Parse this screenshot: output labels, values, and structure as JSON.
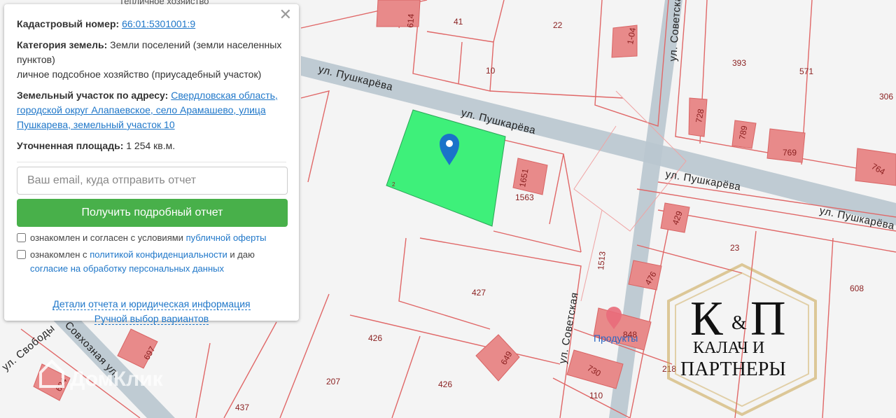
{
  "popup": {
    "cadastral_label": "Кадастровый номер:",
    "cadastral_value": "66:01:5301001:9",
    "category_label": "Категория земель:",
    "category_value": "Земли поселений (земли населенных пунктов)",
    "use_value": "личное подсобное хозяйство (приусадебный участок)",
    "address_label": "Земельный участок по адресу:",
    "address_value": "Свердловская область, городской округ Алапаевское, село Арамашево, улица Пушкарева, земельный участок 10",
    "area_label": "Уточненная площадь:",
    "area_value": "1 254 кв.м.",
    "email_placeholder": "Ваш email, куда отправить отчет",
    "submit_label": "Получить подробный отчет",
    "check1_text": "ознакомлен и согласен с условиями",
    "check1_link": "публичной оферты",
    "check2_text": "ознакомлен с",
    "check2_link": "политикой конфиденциальности",
    "check2_text_b": "и даю",
    "check2_link_b": "согласие на обработку персональных данных",
    "details_link": "Детали отчета и юридическая информация",
    "manual_link": "Ручной выбор вариантов",
    "close_icon": "close-icon"
  },
  "map": {
    "streets": [
      {
        "label": "ул. Пушкарёва"
      },
      {
        "label": "ул. Пушкарёва"
      },
      {
        "label": "ул. Пушкарёва"
      },
      {
        "label": "ул. Пушкарёва"
      },
      {
        "label": "ул. Советская"
      },
      {
        "label": "ул. Советская"
      },
      {
        "label": "Совхозная ул."
      },
      {
        "label": "ул. Свободы"
      }
    ],
    "top_label": "Тепличное хозяйство",
    "plot_numbers": [
      "41",
      "22",
      "10",
      "1-04",
      "393",
      "571",
      "306",
      "728",
      "789",
      "769",
      "764",
      "614",
      "1563",
      "1651",
      "1513",
      "429",
      "23",
      "608",
      "427",
      "426",
      "426",
      "207",
      "437",
      "697",
      "649",
      "730",
      "110",
      "218",
      "848",
      "476",
      "2",
      "624"
    ],
    "poi_label": "Продукты",
    "watermark": "ДомКлик",
    "logo": {
      "line1": "К",
      "amp": "&",
      "line2": "П",
      "line3": "КАЛАЧ И",
      "line4": "ПАРТНЕРЫ"
    },
    "colors": {
      "plot_fill": "#e88a8a",
      "plot_stroke": "#e06767",
      "selected_plot": "#3ef07a",
      "road": "#b9c6cf",
      "marker": "#1a73c9",
      "logo_gold": "#c9a24a"
    }
  }
}
